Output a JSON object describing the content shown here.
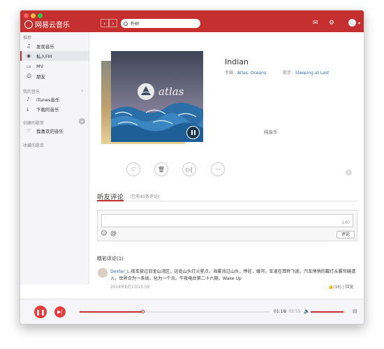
{
  "app": {
    "title": "网易云音乐"
  },
  "search": {
    "query": "朴树"
  },
  "sidebar": {
    "section_recommend": "推荐",
    "items": [
      {
        "label": "发现音乐",
        "icon": "music-note-icon"
      },
      {
        "label": "私人FM",
        "icon": "radio-icon",
        "active": true
      },
      {
        "label": "MV",
        "icon": "tv-icon"
      },
      {
        "label": "朋友",
        "icon": "friends-icon"
      }
    ],
    "section_my_music": "我的音乐",
    "my_music": [
      {
        "label": "iTunes音乐",
        "icon": "itunes-icon"
      },
      {
        "label": "下载的音乐",
        "icon": "download-icon"
      }
    ],
    "section_created": "创建的歌单",
    "created": [
      {
        "label": "我喜欢的音乐",
        "icon": "heart-icon"
      }
    ],
    "section_collected": "收藏的歌单"
  },
  "player": {
    "song_title": "Indian",
    "album_label": "专辑:",
    "album": "Atlas: Oceans",
    "artist_label": "歌手:",
    "artist": "Sleeping at Last",
    "lyric_placeholder": "纯音乐",
    "album_art_text": "atlas",
    "current_time": "01:18",
    "total_time": "/ 03:55",
    "progress": 0.33,
    "volume": 0.93
  },
  "comments": {
    "title": "听友评论",
    "count": "(已有40条评论)",
    "char_limit": "140",
    "submit": "评论",
    "hot_title": "精彩评论(1)",
    "list": [
      {
        "user": "Dexter_L:",
        "text": "夜车驶过旧金山湾区，远处山头灯火星点，海雾流过山头，停驻，缓泻，车道在耳畔飞逝。汽车悄悄的戴灯从雾帘缝透入，世界合为一条线，化为一个点。午夜电台第二十六期，Wake Up",
        "time": "2014年8月1日15:59",
        "likes": "(16)",
        "reply": "回复"
      }
    ]
  },
  "colors": {
    "brand": "#c62f2f",
    "link": "#2d6aa9"
  }
}
